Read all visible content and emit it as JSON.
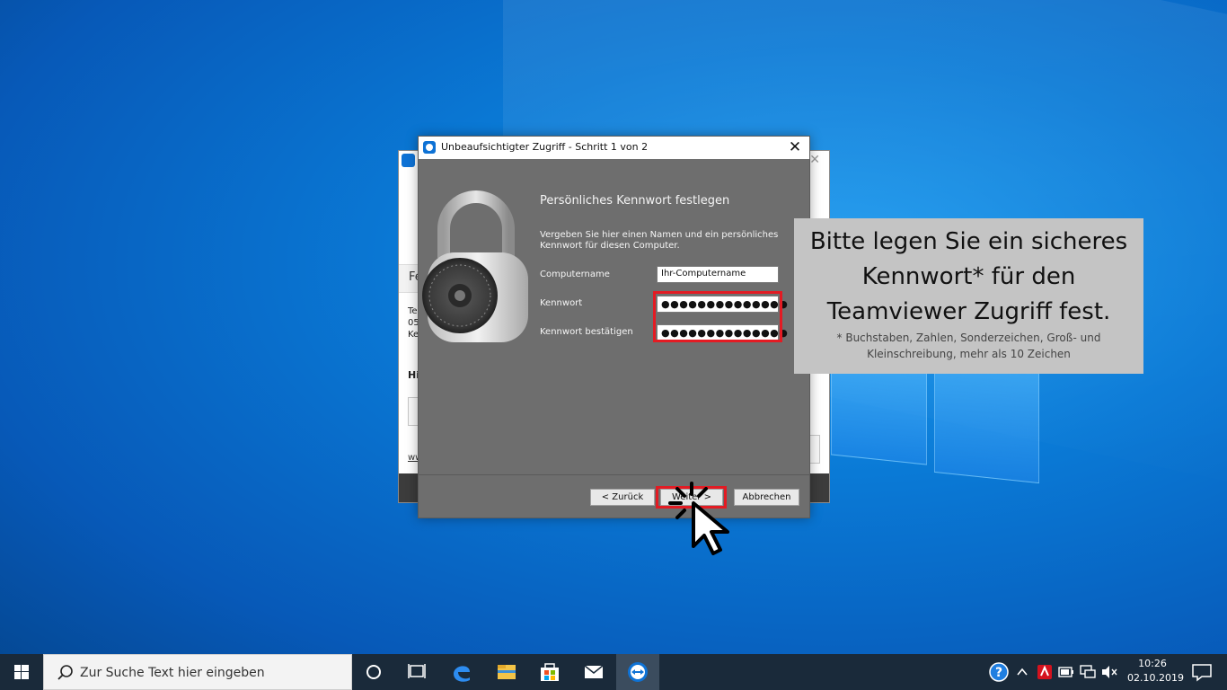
{
  "dialog": {
    "title": "Unbeaufsichtigter Zugriff - Schritt 1 von 2",
    "heading": "Persönliches Kennwort festlegen",
    "description": "Vergeben Sie hier einen Namen und ein persönliches Kennwort für diesen Computer.",
    "fields": {
      "computername_label": "Computername",
      "computername_value": "Ihr-Computername",
      "password_label": "Kennwort",
      "password_value": "●●●●●●●●●●●●●●",
      "confirm_label": "Kennwort bestätigen",
      "confirm_value": "●●●●●●●●●●●●●●"
    },
    "buttons": {
      "back": "< Zurück",
      "next": "Weiter >",
      "cancel": "Abbrechen"
    }
  },
  "background_window": {
    "strip_text": "Fe",
    "lines": [
      "Te",
      "05",
      "Ke"
    ],
    "bold_text": "Hi",
    "link_text": "ww"
  },
  "callout": {
    "main_text": "Bitte legen Sie ein sicheres Kennwort* für den Teamviewer Zugriff fest.",
    "note": "* Buchstaben, Zahlen, Sonderzeichen, Groß- und Kleinschreibung, mehr als 10 Zeichen"
  },
  "taskbar": {
    "search_placeholder": "Zur Suche Text hier eingeben",
    "time": "10:26",
    "date": "02.10.2019"
  },
  "colors": {
    "highlight": "#e31b23",
    "teamviewer": "#0e72d5",
    "dialog_bg": "#6e6e6e",
    "callout_bg": "#c4c4c4"
  }
}
